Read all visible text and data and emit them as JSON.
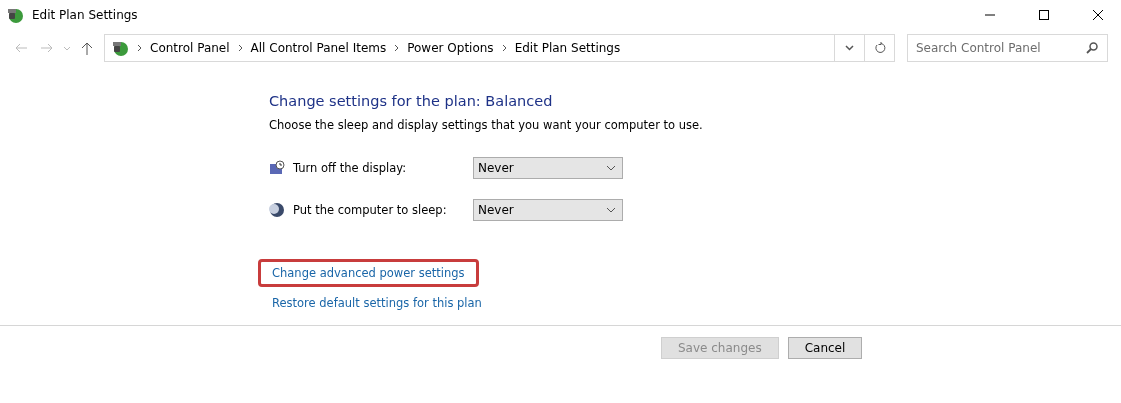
{
  "window": {
    "title": "Edit Plan Settings"
  },
  "breadcrumb": [
    "Control Panel",
    "All Control Panel Items",
    "Power Options",
    "Edit Plan Settings"
  ],
  "search": {
    "placeholder": "Search Control Panel"
  },
  "heading": "Change settings for the plan: Balanced",
  "description": "Choose the sleep and display settings that you want your computer to use.",
  "settings": [
    {
      "kind": "display",
      "label": "Turn off the display:",
      "value": "Never"
    },
    {
      "kind": "sleep",
      "label": "Put the computer to sleep:",
      "value": "Never"
    }
  ],
  "links": [
    {
      "label": "Change advanced power settings",
      "highlighted": true
    },
    {
      "label": "Restore default settings for this plan",
      "highlighted": false
    }
  ],
  "buttons": [
    {
      "label": "Save changes",
      "disabled": true
    },
    {
      "label": "Cancel",
      "disabled": false
    }
  ]
}
